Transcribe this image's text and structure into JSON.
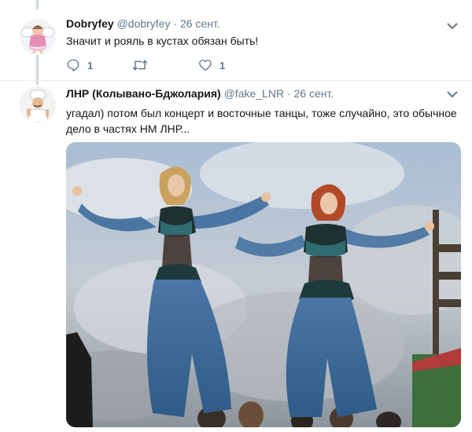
{
  "tweets": [
    {
      "name": "Dobryfey",
      "handle": "@dobryfey",
      "date": "26 сент.",
      "text": "Значит и рояль в кустах обязан быть!",
      "replies": "1",
      "retweets": "",
      "likes": "1"
    },
    {
      "name": "ЛНР (Колывано-Бджолария)",
      "handle": "@fake_LNR",
      "date": "26 сент.",
      "text_line1": "угадал) потом был концерт и восточные танцы, тоже случайно, это обычное",
      "text_line2": "дело в частях НМ ЛНР..."
    }
  ],
  "icons": {
    "reply": "reply-icon",
    "retweet": "retweet-icon",
    "like": "heart-icon",
    "caret": "chevron-down-icon"
  },
  "colors": {
    "text": "#14171a",
    "secondary": "#657786",
    "thread": "#ccd6dd"
  }
}
